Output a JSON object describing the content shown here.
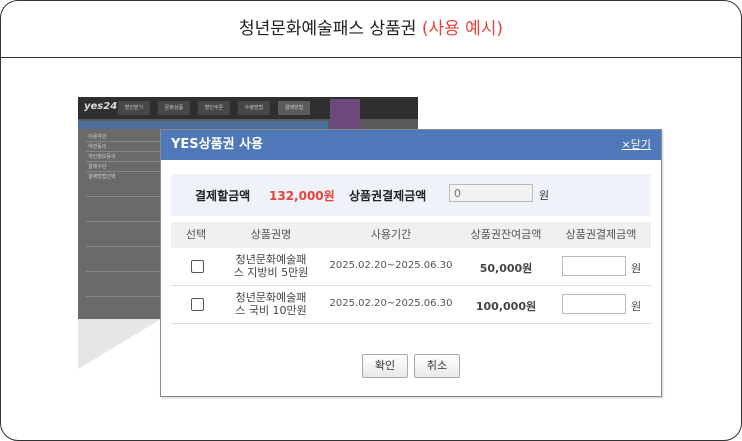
{
  "frame": {
    "title_main": "청년문화예술패스 상품권 ",
    "title_highlight": "(사용 예시)"
  },
  "background": {
    "logo": "yes24",
    "tabs": [
      "할인받기",
      "문화상품",
      "할인쿠폰",
      "수령방법",
      "결제방법"
    ],
    "form_labels": [
      "이용약관",
      "약관동의",
      "개인정보동의",
      "결제수단",
      "결제방법선택"
    ]
  },
  "dialog": {
    "title": "YES상품권 사용",
    "close_label": "×닫기",
    "summary": {
      "pay_label": "결제할금액",
      "pay_amount": "132,000원",
      "voucher_label": "상품권결제금액",
      "voucher_placeholder": "0",
      "unit": "원"
    },
    "table": {
      "headers": [
        "선택",
        "상품권명",
        "사용기간",
        "상품권잔여금액",
        "상품권결제금액"
      ],
      "rows": [
        {
          "name_line1": "청년문화예술패",
          "name_line2": "스 지방비 5만원",
          "period": "2025.02.20~2025.06.30",
          "balance": "50,000원",
          "unit": "원"
        },
        {
          "name_line1": "청년문화예술패",
          "name_line2": "스 국비 10만원",
          "period": "2025.02.20~2025.06.30",
          "balance": "100,000원",
          "unit": "원"
        }
      ]
    },
    "confirm_label": "확인",
    "cancel_label": "취소"
  },
  "colors": {
    "accent": "#e8423a",
    "dialog_header": "#4f78b8",
    "summary_bg": "#eef3f9"
  }
}
